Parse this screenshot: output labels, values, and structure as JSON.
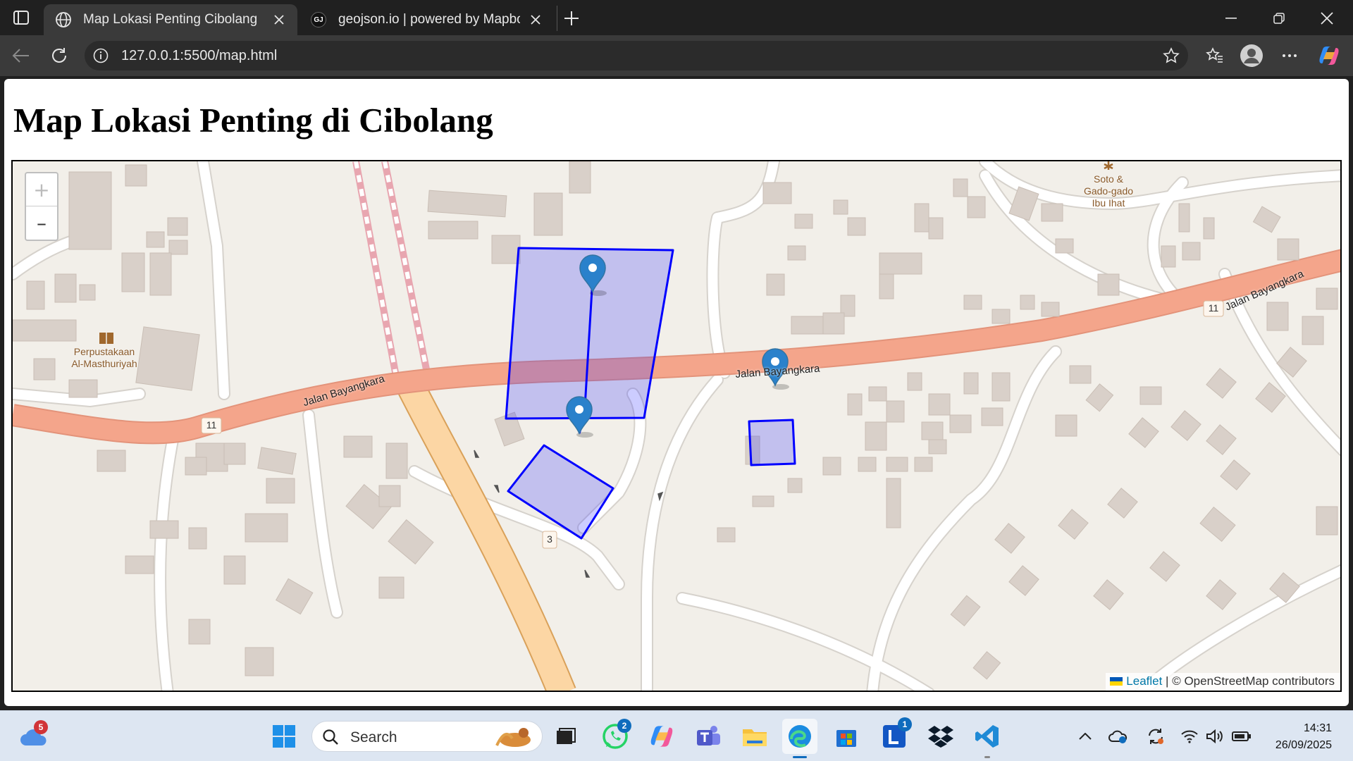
{
  "browser": {
    "tabs": [
      {
        "label": "Map Lokasi Penting Cibolang",
        "active": true,
        "icon": "globe-icon"
      },
      {
        "label": "geojson.io | powered by Mapbox",
        "active": false,
        "icon": "geojson-favicon",
        "favicon_text": "GJ"
      }
    ],
    "url": "127.0.0.1:5500/map.html"
  },
  "page": {
    "title": "Map Lokasi Penting di Cibolang"
  },
  "map": {
    "zoom_in": "+",
    "zoom_out": "–",
    "road_main": "Jalan Bayangkara",
    "road_label_middle": "Jalan Bayangkara",
    "road_label_right": "Jalan Bayangkara",
    "route_shield_11": "11",
    "route_shield_3": "3",
    "poi_library_line1": "Perpustakaan",
    "poi_library_line2": "Al-Masthuriyah",
    "poi_food_line1": "Soto &",
    "poi_food_line2": "Gado-gado",
    "poi_food_line3": "Ibu Ihat",
    "attribution_link": "Leaflet",
    "attribution_text": " | © OpenStreetMap contributors",
    "colors": {
      "polygon_stroke": "#0000ff",
      "polygon_fill": "#8080ff",
      "marker": "#2a81cb",
      "road_main": "#f4a58b",
      "road_secondary": "#fcd6a4"
    }
  },
  "taskbar": {
    "weather_badge": "5",
    "search_placeholder": "Search",
    "whatsapp_badge": "2",
    "l_app_badge": "1",
    "time": "14:31",
    "date": "26/09/2025"
  }
}
